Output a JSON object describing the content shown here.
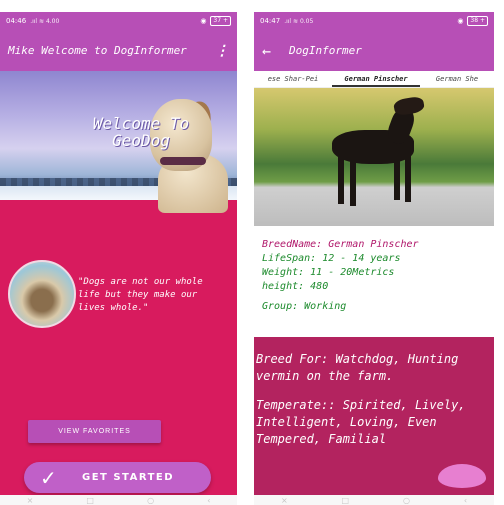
{
  "left": {
    "status": {
      "time": "04:46",
      "signal": ".ııl ≋ 4.00",
      "battery": "37 +"
    },
    "appbar": {
      "title": "Mike Welcome to DogInformer",
      "menu": "⋮"
    },
    "hero": {
      "title": "Welcome To GeoDog"
    },
    "quote": "\"Dogs are not our whole life but they make our lives whole.\"",
    "buttons": {
      "favorites": "VIEW FAVORITES",
      "start": "GET STARTED",
      "start_icon": "✓"
    }
  },
  "right": {
    "status": {
      "time": "04:47",
      "signal": ".ııl ≋ 0.05",
      "battery": "38 +"
    },
    "appbar": {
      "title": "DogInformer",
      "back": "←"
    },
    "tabs": [
      "ese Shar-Pei",
      "German Pinscher",
      "German She"
    ],
    "info": {
      "breed": "BreedName: German Pinscher",
      "lifespan": "LifeSpan: 12 - 14 years",
      "weight": "Weight: 11 - 20Metrics",
      "height": "height: 480",
      "group": "Group: Working"
    },
    "desc": {
      "bred_for": "Breed For: Watchdog, Hunting vermin on the farm.",
      "temperament": "Temperate:: Spirited, Lively, Intelligent, Loving, Even Tempered, Familial"
    }
  },
  "nav": {
    "back": "‹",
    "home": "○",
    "recent": "□",
    "more": "×"
  },
  "colors": {
    "appbar": "#b74fb6",
    "background": "#d81b5e",
    "desc_bg": "#b3235f"
  }
}
